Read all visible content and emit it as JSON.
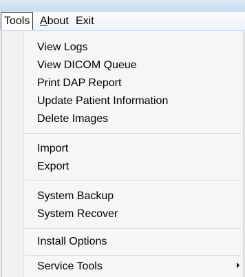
{
  "menubar": {
    "items": [
      {
        "label": "Tools",
        "mnemonic": "",
        "rest": "Tools"
      },
      {
        "label": "About",
        "mnemonic": "A",
        "rest": "bout"
      },
      {
        "label": "Exit",
        "mnemonic": "",
        "rest": "Exit"
      }
    ]
  },
  "tools_menu": {
    "groups": [
      {
        "items": [
          "View Logs",
          "View DICOM Queue",
          "Print DAP Report",
          "Update Patient Information",
          "Delete Images"
        ]
      },
      {
        "items": [
          "Import",
          "Export"
        ]
      },
      {
        "items": [
          "System Backup",
          "System Recover"
        ]
      },
      {
        "items": [
          "Install Options"
        ]
      },
      {
        "items": [
          "Service Tools"
        ]
      }
    ],
    "submenu_icon": "chevron-right-icon"
  }
}
